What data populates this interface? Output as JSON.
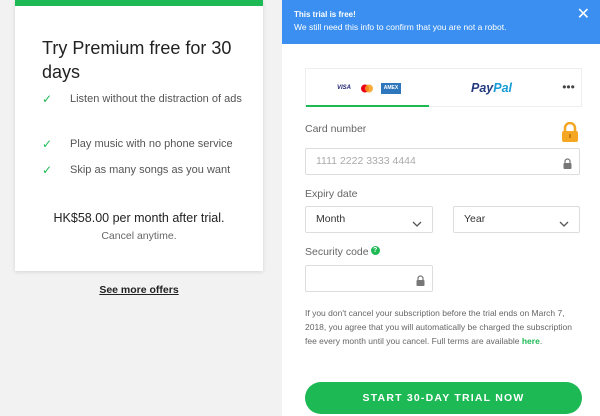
{
  "offer": {
    "title": "Try Premium free for 30 days",
    "features": [
      "Listen without the distraction of ads",
      "Play music with no phone service",
      "Skip as many songs as you want"
    ],
    "price": "HK$58.00 per month after trial.",
    "cancel_note": "Cancel anytime.",
    "see_more": "See more offers"
  },
  "notice": {
    "title": "This trial is free!",
    "text": "We still need this info to confirm that you are not a robot."
  },
  "tabs": {
    "cards": [
      "VISA",
      "mastercard",
      "AMEX"
    ],
    "paypal_a": "Pay",
    "paypal_b": "Pal",
    "more": "•••"
  },
  "form": {
    "card_number_label": "Card number",
    "card_number_placeholder": "1111 2222 3333 4444",
    "expiry_label": "Expiry date",
    "month": "Month",
    "year": "Year",
    "security_label": "Security code",
    "help": "?"
  },
  "terms": {
    "text": "If you don't cancel your subscription before the trial ends on March 7, 2018, you agree that you will automatically be charged the subscription fee every month until you cancel. Full terms are available ",
    "link": "here",
    "end": "."
  },
  "cta": {
    "label": "START 30-DAY TRIAL NOW"
  },
  "colors": {
    "accent": "#1db954",
    "notice": "#3a8ff0",
    "paypal_dark": "#253b80",
    "paypal_light": "#179bd7",
    "lock": "#f5a623"
  }
}
